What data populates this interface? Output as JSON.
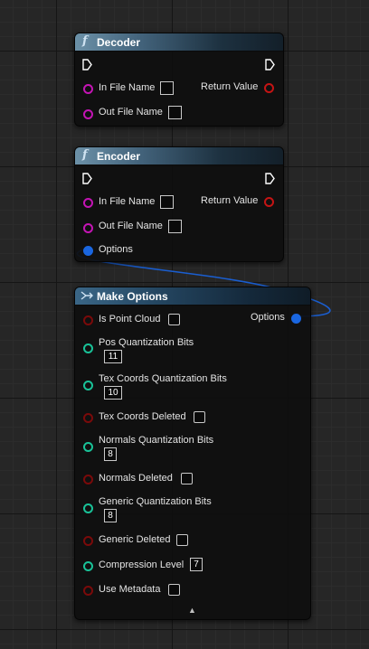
{
  "nodes": {
    "decoder": {
      "title": "Decoder",
      "icon": "function-icon",
      "inputs": [
        "In File Name",
        "Out File Name"
      ],
      "output": "Return Value"
    },
    "encoder": {
      "title": "Encoder",
      "icon": "function-icon",
      "inputs": [
        "In File Name",
        "Out File Name",
        "Options"
      ],
      "output": "Return Value"
    },
    "make_options": {
      "title": "Make Options",
      "icon": "make-struct-icon",
      "output": "Options",
      "fields": {
        "is_point_cloud": "Is Point Cloud",
        "pos_quant": {
          "label": "Pos Quantization Bits",
          "value": "11"
        },
        "tex_quant": {
          "label": "Tex Coords Quantization Bits",
          "value": "10"
        },
        "tex_deleted": "Tex Coords Deleted",
        "normals_quant": {
          "label": "Normals Quantization Bits",
          "value": "8"
        },
        "normals_deleted": "Normals Deleted",
        "generic_quant": {
          "label": "Generic Quantization Bits",
          "value": "8"
        },
        "generic_deleted": "Generic Deleted",
        "compression": {
          "label": "Compression Level",
          "value": "7"
        },
        "use_metadata": "Use Metadata"
      },
      "collapse_glyph": "▲"
    }
  },
  "colors": {
    "string_pin": "#c414b4",
    "bool_pin": "#7a0a0a",
    "int_pin": "#19c298",
    "struct_pin": "#1a66e0",
    "wire": "#1a5ed0"
  }
}
